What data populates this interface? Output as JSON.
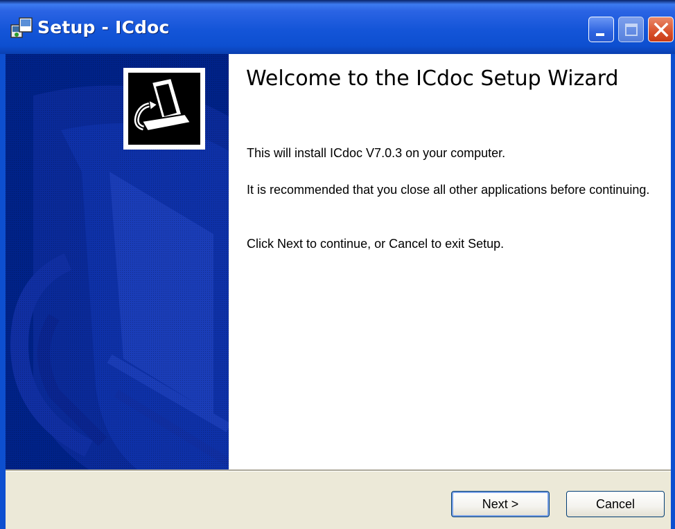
{
  "window": {
    "title": "Setup - ICdoc",
    "app_icon": "setup-installer-icon",
    "controls": {
      "minimize_icon": "minimize-icon",
      "maximize_icon": "maximize-icon",
      "close_icon": "close-icon"
    }
  },
  "banner": {
    "logo_icon": "computer-install-icon",
    "background_color": "#002288"
  },
  "welcome": {
    "heading": "Welcome to the ICdoc Setup Wizard",
    "paragraphs": [
      "This will install ICdoc V7.0.3 on your computer.",
      "It is recommended that you close all other applications before continuing.",
      "Click Next to continue, or Cancel to exit Setup."
    ]
  },
  "buttons": {
    "next_label": "Next >",
    "cancel_label": "Cancel"
  },
  "colors": {
    "titlebar": "#0d4fd0",
    "dialog_background": "#ece9d8",
    "close_button": "#d9522c"
  }
}
